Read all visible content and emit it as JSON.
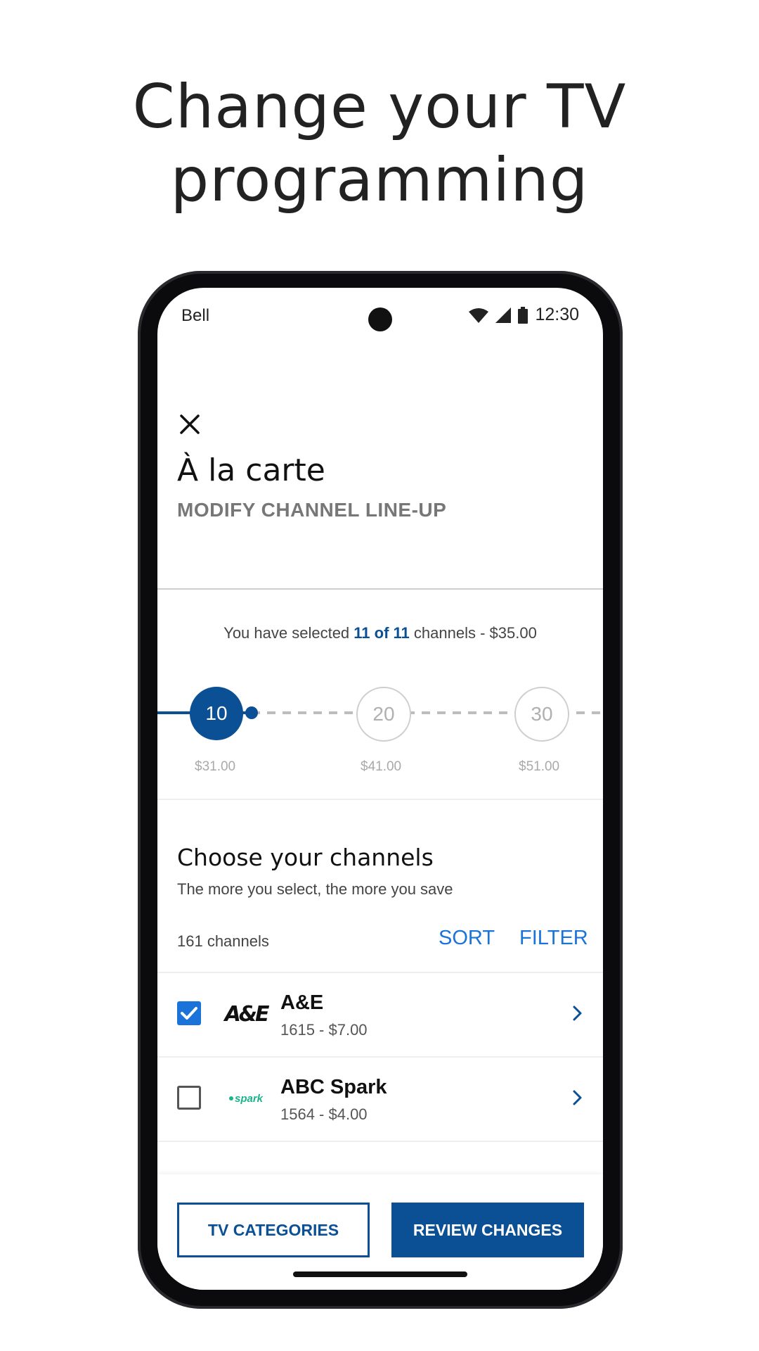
{
  "headline": {
    "line1": "Change your TV",
    "line2": "programming"
  },
  "status_bar": {
    "carrier": "Bell",
    "time": "12:30"
  },
  "page": {
    "title": "À la carte",
    "subtitle": "MODIFY CHANNEL LINE-UP"
  },
  "selection": {
    "prefix": "You have selected ",
    "highlight": "11 of 11",
    "suffix": " channels - $35.00"
  },
  "tiers": [
    {
      "count": "10",
      "price": "$31.00",
      "active": true
    },
    {
      "count": "20",
      "price": "$41.00",
      "active": false
    },
    {
      "count": "30",
      "price": "$51.00",
      "active": false
    }
  ],
  "channels_section": {
    "title": "Choose your channels",
    "subtitle": "The more you select, the more you save",
    "count_label": "161 channels",
    "sort_label": "SORT",
    "filter_label": "FILTER"
  },
  "channels": [
    {
      "name": "A&E",
      "detail": "1615 - $7.00",
      "logo_text": "A&E",
      "checked": true
    },
    {
      "name": "ABC Spark",
      "detail": "1564 - $4.00",
      "logo_text": "spark",
      "checked": false
    }
  ],
  "buttons": {
    "categories": "TV CATEGORIES",
    "review": "REVIEW CHANGES"
  },
  "colors": {
    "brand_blue": "#0b4f95",
    "link_blue": "#1a73d9",
    "spark_green": "#1ab38a"
  }
}
